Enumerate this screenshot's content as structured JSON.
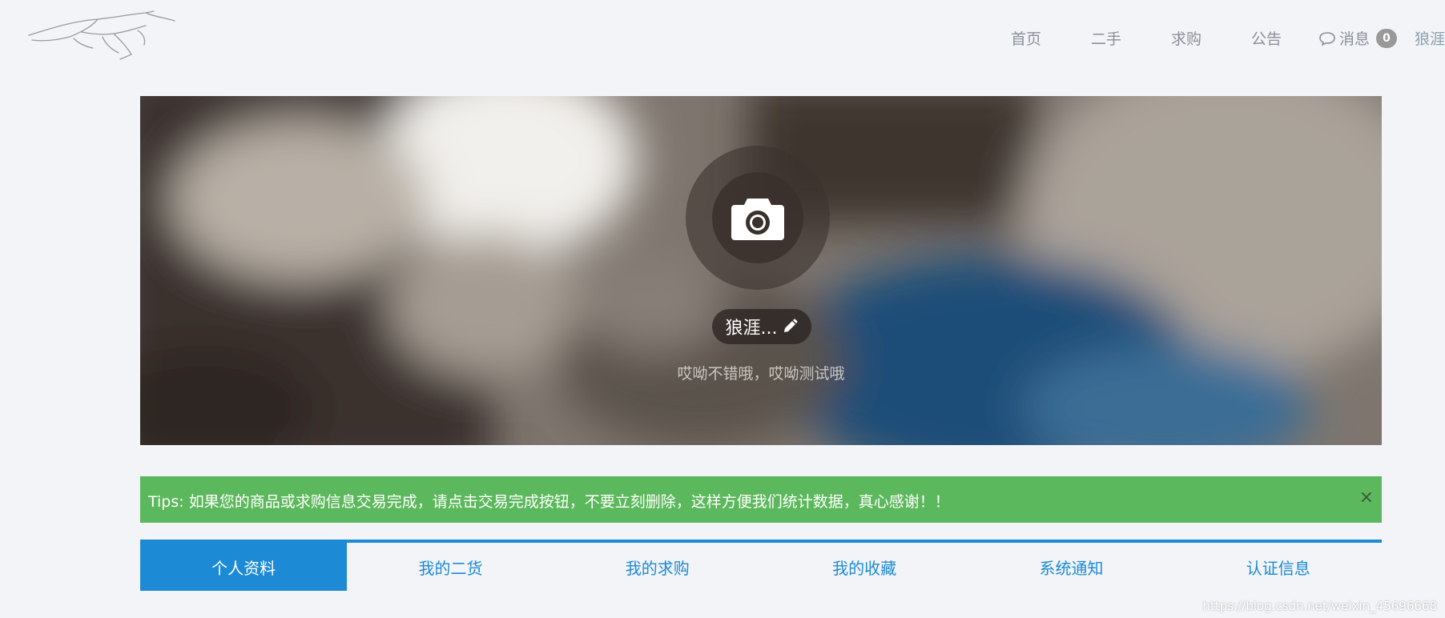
{
  "header": {
    "logo": "running-greyhound-logo",
    "nav": [
      {
        "label": "首页"
      },
      {
        "label": "二手"
      },
      {
        "label": "求购"
      },
      {
        "label": "公告"
      }
    ],
    "messages": {
      "label": "消息",
      "count": "0",
      "icon": "chat-bubble-icon"
    },
    "user": {
      "label": "狼涯."
    }
  },
  "banner": {
    "avatar_icon": "camera-icon",
    "name": "狼涯...",
    "edit_icon": "pencil-icon",
    "signature": "哎呦不错哦，哎呦测试哦"
  },
  "tips": {
    "text": "Tips: 如果您的商品或求购信息交易完成，请点击交易完成按钮，不要立刻删除，这样方便我们统计数据，真心感谢！！",
    "close": "×"
  },
  "tabs": [
    {
      "label": "个人资料",
      "active": true
    },
    {
      "label": "我的二货"
    },
    {
      "label": "我的求购"
    },
    {
      "label": "我的收藏"
    },
    {
      "label": "系统通知"
    },
    {
      "label": "认证信息"
    }
  ],
  "watermark": "https://blog.csdn.net/weixin_45696668",
  "colors": {
    "accent": "#1c8ad5",
    "tips_bg": "#5cb85c",
    "page_bg": "#f3f4f8"
  }
}
